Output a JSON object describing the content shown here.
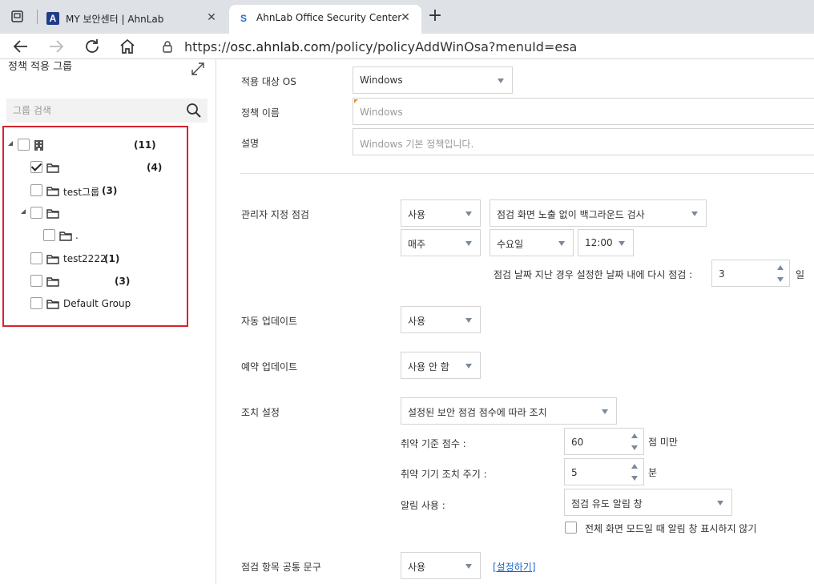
{
  "browser": {
    "tabs": [
      {
        "title": "MY 보안센터 | AhnLab",
        "favicon": "A",
        "active": false
      },
      {
        "title": "AhnLab Office Security Center",
        "favicon": "S",
        "active": true
      }
    ],
    "url_prefix": "https://",
    "url_host": "osc.ahnlab.com",
    "url_path": "/policy/policyAddWinOsa?menuId=esa"
  },
  "left_panel": {
    "title": "정책 적용 그룹",
    "search_placeholder": "그룹 검색",
    "tree": [
      {
        "label": "",
        "count": "(11)",
        "checked": false,
        "expanded": true,
        "icon": "building-icon"
      },
      {
        "label": "",
        "count": "(4)",
        "checked": true,
        "icon": "folder-icon"
      },
      {
        "label": "test그룹",
        "count": "(3)",
        "checked": false,
        "icon": "folder-icon"
      },
      {
        "label": "",
        "count": "",
        "checked": false,
        "expanded": true,
        "icon": "folder-icon"
      },
      {
        "label": ".",
        "count": "",
        "checked": false,
        "icon": "folder-icon"
      },
      {
        "label": "test2222",
        "count": "(1)",
        "checked": false,
        "icon": "folder-icon"
      },
      {
        "label": "",
        "count": "(3)",
        "checked": false,
        "icon": "folder-icon"
      },
      {
        "label": "Default Group",
        "count": "",
        "checked": false,
        "icon": "folder-icon"
      }
    ]
  },
  "form": {
    "target_os": {
      "label": "적용 대상 OS",
      "value": "Windows"
    },
    "policy_name": {
      "label": "정책 이름",
      "placeholder": "Windows"
    },
    "description": {
      "label": "설명",
      "placeholder": "Windows 기본 정책입니다."
    },
    "admin_check": {
      "label": "관리자 지정 점검",
      "use": "사용",
      "mode": "점검 화면 노출 없이 백그라운드 검사",
      "period": "매주",
      "day": "수요일",
      "time": "12:00",
      "recheck_label": "점검 날짜 지난 경우 설정한 날짜 내에 다시 점검 :",
      "recheck_value": "3",
      "recheck_unit": "일"
    },
    "auto_update": {
      "label": "자동 업데이트",
      "value": "사용"
    },
    "scheduled_update": {
      "label": "예약 업데이트",
      "value": "사용 안 함"
    },
    "action": {
      "label": "조치 설정",
      "value": "설정된 보안 점검 점수에 따라 조치",
      "threshold_label": "취약 기준 점수 :",
      "threshold_value": "60",
      "threshold_unit": "점 미만",
      "cycle_label": "취약 기기 조치 주기 :",
      "cycle_value": "5",
      "cycle_unit": "분",
      "alert_label": "알림 사용 :",
      "alert_value": "점검 유도 알림 창",
      "fullscreen_label": "전체 화면 모드일 때 알림 창 표시하지 않기"
    },
    "common_text": {
      "label": "점검 항목 공통 문구",
      "value": "사용",
      "link": "[설정하기]"
    }
  }
}
